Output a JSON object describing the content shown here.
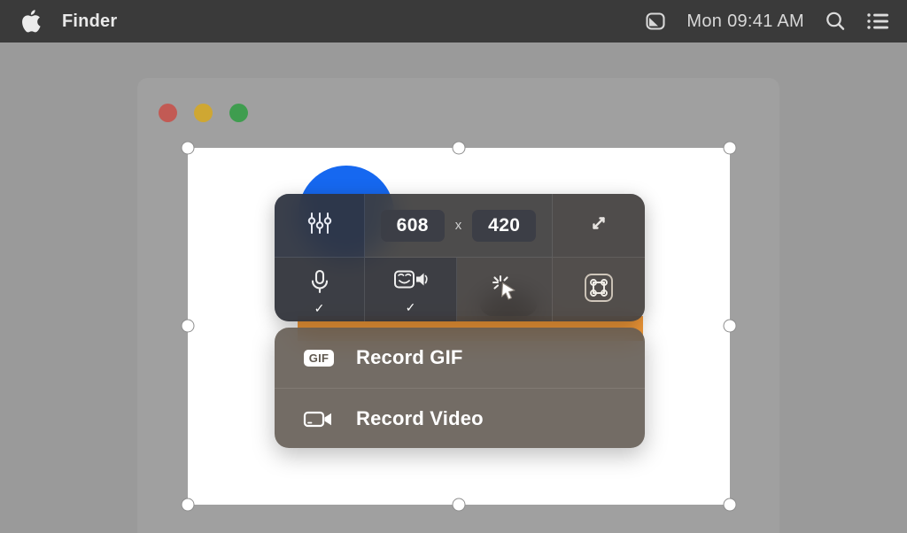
{
  "menubar": {
    "apple_icon": "apple-logo-icon",
    "app_name": "Finder",
    "capture_icon": "screen-capture-icon",
    "clock": "Mon 09:41 AM",
    "search_icon": "search-icon",
    "control_center_icon": "control-center-icon"
  },
  "window": {
    "close_label": "close",
    "minimize_label": "minimize",
    "zoom_label": "zoom"
  },
  "capture_toolbar": {
    "settings_icon": "sliders-icon",
    "width_value": "608",
    "separator": "x",
    "height_value": "420",
    "expand_icon": "expand-arrows-icon",
    "mic_icon": "microphone-icon",
    "mic_enabled_mark": "✓",
    "system_audio_icon": "system-audio-icon",
    "system_audio_enabled_mark": "✓",
    "click_highlight_icon": "click-highlight-cursor-icon",
    "shortcut_icon": "command-key-icon",
    "shortcut_glyph": "⌘"
  },
  "record_menu": {
    "items": [
      {
        "icon": "gif-badge-icon",
        "badge": "GIF",
        "label": "Record GIF"
      },
      {
        "icon": "video-camera-icon",
        "badge": "",
        "label": "Record Video"
      }
    ]
  },
  "colors": {
    "menubar_bg": "#3a3a3a",
    "desktop_bg": "#9a9a9a",
    "window_bg": "#a0a0a0",
    "capture_bg": "#ffffff",
    "accent_blue": "#1668f0",
    "accent_orange": "#f59b39",
    "traffic_red": "#c25a54",
    "traffic_yellow": "#cfa732",
    "traffic_green": "#3f9d4f"
  }
}
